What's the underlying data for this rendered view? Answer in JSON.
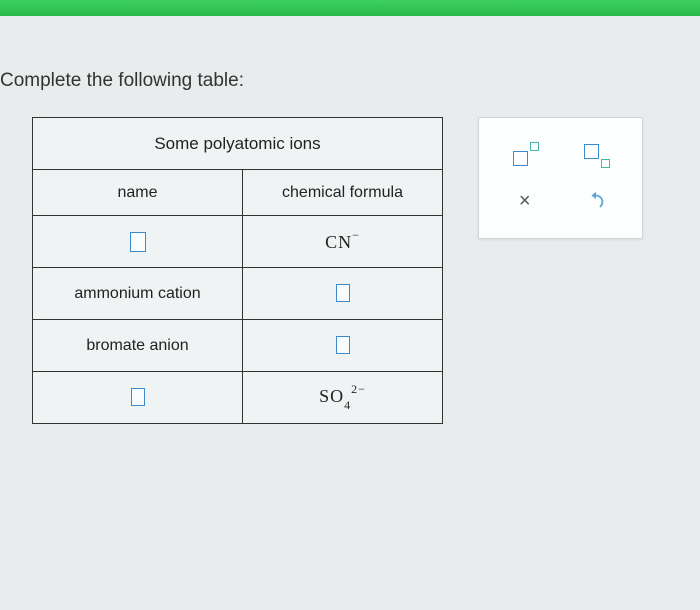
{
  "prompt": "Complete the following table:",
  "table": {
    "title": "Some polyatomic ions",
    "headers": {
      "name": "name",
      "formula": "chemical formula"
    },
    "rows": [
      {
        "name": null,
        "formula": {
          "base": "CN",
          "sup": "−",
          "sub": ""
        }
      },
      {
        "name": "ammonium cation",
        "formula": null
      },
      {
        "name": "bromate anion",
        "formula": null
      },
      {
        "name": null,
        "formula": {
          "base": "SO",
          "sup": "2−",
          "sub": "4"
        }
      }
    ]
  },
  "tools": {
    "superscript": "superscript-template",
    "subscript": "subscript-template",
    "clear": "×",
    "reset": "reset"
  }
}
